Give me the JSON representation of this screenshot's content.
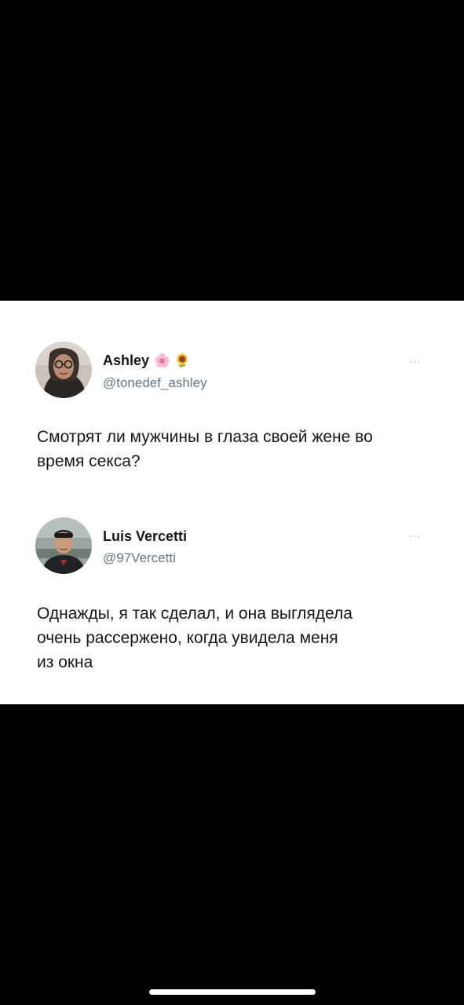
{
  "tweets": [
    {
      "name": "Ashley",
      "name_emoji": "🌸 🌻",
      "handle": "@tonedef_ashley",
      "more_icon": "more-dots-icon",
      "more_glyph": "···",
      "text": "Смотрят ли мужчины в глаза своей жене во\nвремя секса?"
    },
    {
      "name": "Luis Vercetti",
      "handle": "@97Vercetti",
      "more_icon": "more-dots-icon",
      "more_glyph": "···",
      "text": "Однажды, я так сделал, и она выглядела\nочень рассержено, когда увидела меня\nиз окна"
    }
  ],
  "colors": {
    "background": "#000000",
    "card": "#ffffff",
    "text": "#14171a",
    "handle": "#657786"
  }
}
